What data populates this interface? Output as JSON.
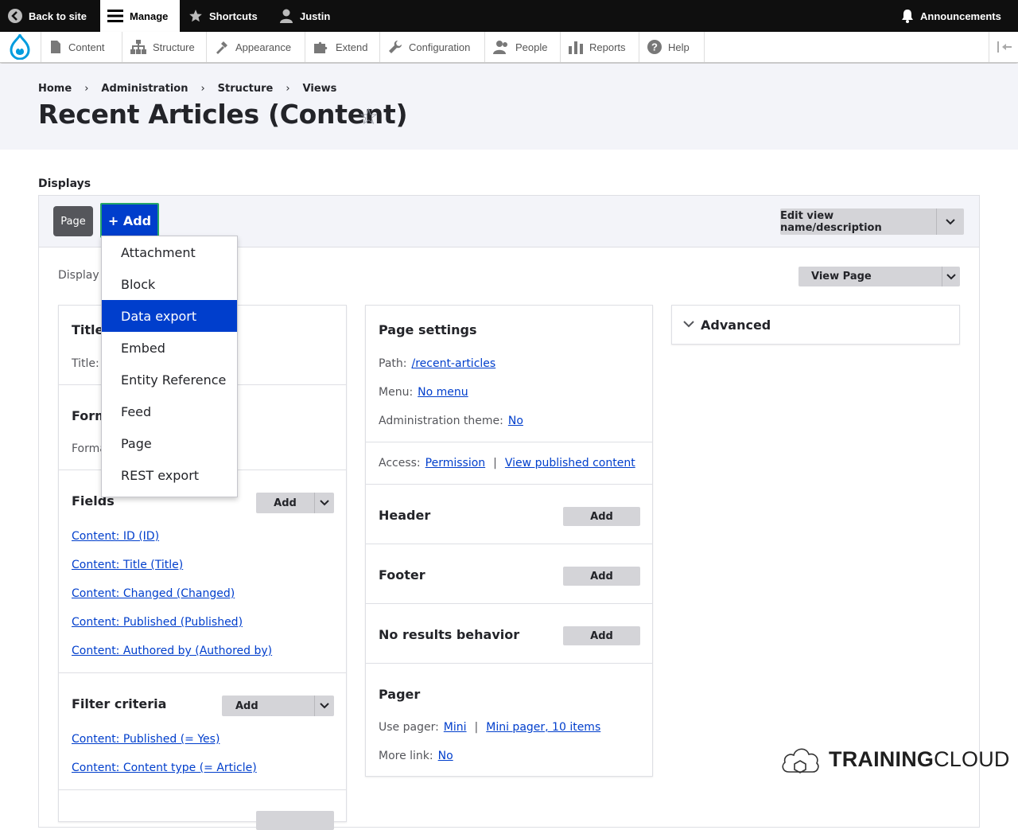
{
  "toolbar": {
    "back": "Back to site",
    "manage": "Manage",
    "shortcuts": "Shortcuts",
    "user": "Justin",
    "announcements": "Announcements"
  },
  "tray": {
    "items": [
      "Content",
      "Structure",
      "Appearance",
      "Extend",
      "Configuration",
      "People",
      "Reports",
      "Help"
    ]
  },
  "breadcrumb": [
    "Home",
    "Administration",
    "Structure",
    "Views"
  ],
  "page_title": "Recent Articles (Content)",
  "displays": {
    "label": "Displays",
    "tab_page": "Page",
    "add": "+ Add",
    "edit_view": "Edit view name/description",
    "display_name_prefix": "Display n",
    "view_page": "View Page"
  },
  "menu": {
    "items": [
      "Attachment",
      "Block",
      "Data export",
      "Embed",
      "Entity Reference",
      "Feed",
      "Page",
      "REST export"
    ],
    "selected": "Data export"
  },
  "left_col": {
    "title_head": "Title",
    "title_label": "Title:",
    "format_head": "Form",
    "format_label": "Forma",
    "fields_head": "Fields",
    "fields_add": "Add",
    "fields": [
      "Content: ID (ID)",
      "Content: Title (Title)",
      "Content: Changed (Changed)",
      "Content: Published (Published)",
      "Content: Authored by (Authored by)"
    ],
    "filter_head": "Filter criteria",
    "filter_add": "Add",
    "filters": [
      "Content: Published (= Yes)",
      "Content: Content type (= Article)"
    ]
  },
  "mid_col": {
    "page_settings": "Page settings",
    "path_label": "Path:",
    "path_value": "/recent-articles",
    "menu_label": "Menu:",
    "menu_value": "No menu",
    "admin_label": "Administration theme:",
    "admin_value": "No",
    "access_label": "Access:",
    "access_value1": "Permission",
    "access_value2": "View published content",
    "header": "Header",
    "footer": "Footer",
    "no_results": "No results behavior",
    "add": "Add",
    "pager": "Pager",
    "use_pager_label": "Use pager:",
    "use_pager_value1": "Mini",
    "use_pager_value2": "Mini pager, 10 items",
    "more_link_label": "More link:",
    "more_link_value": "No"
  },
  "right_col": {
    "advanced": "Advanced"
  },
  "watermark": {
    "bold": "TRAINING",
    "light": "CLOUD"
  }
}
